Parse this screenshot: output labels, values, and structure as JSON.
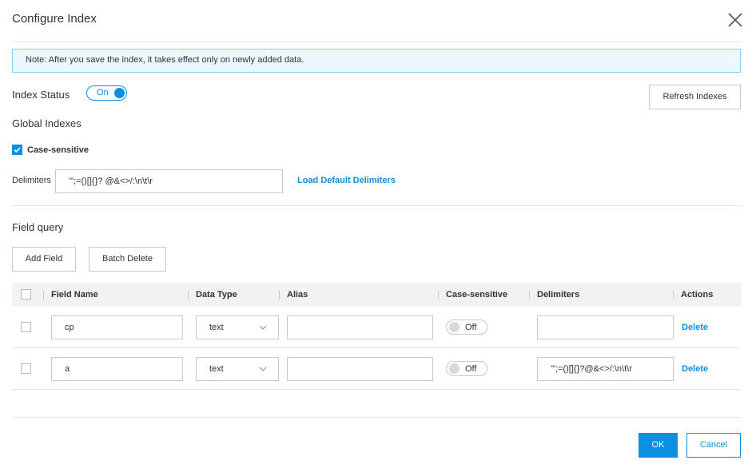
{
  "dialog": {
    "title": "Configure Index",
    "notice": "Note: After you save the index, it takes effect only on newly added data."
  },
  "index_status": {
    "label": "Index Status",
    "toggle_label": "On",
    "enabled": true
  },
  "refresh_button": "Refresh Indexes",
  "global_indexes": {
    "title": "Global Indexes",
    "case_sensitive_label": "Case-sensitive",
    "case_sensitive_checked": true,
    "delimiters_label": "Delimiters",
    "delimiters_value": "'\";=()[]{}? @&<>/:\\n\\t\\r",
    "load_default": "Load Default Delimiters"
  },
  "field_query": {
    "title": "Field query",
    "add_button": "Add Field",
    "batch_delete_button": "Batch Delete"
  },
  "table": {
    "headers": [
      "Field Name",
      "Data Type",
      "Alias",
      "Case-sensitive",
      "Delimiters",
      "Actions"
    ],
    "rows": [
      {
        "field_name": "cp",
        "data_type": "text",
        "alias": "",
        "case_sensitive": "Off",
        "delimiters": "",
        "action": "Delete"
      },
      {
        "field_name": "a",
        "data_type": "text",
        "alias": "",
        "case_sensitive": "Off",
        "delimiters": "'\";=()[]{}?@&<>/:\\n\\t\\r",
        "action": "Delete"
      }
    ]
  },
  "footer": {
    "ok": "OK",
    "cancel": "Cancel"
  },
  "colors": {
    "accent": "#0b8fe0",
    "notice_bg": "#ebf8fd",
    "notice_border": "#88cfee",
    "header_bg": "#f2f2f2"
  },
  "icons": [
    "close-icon",
    "check-icon",
    "chevron-down-icon"
  ]
}
